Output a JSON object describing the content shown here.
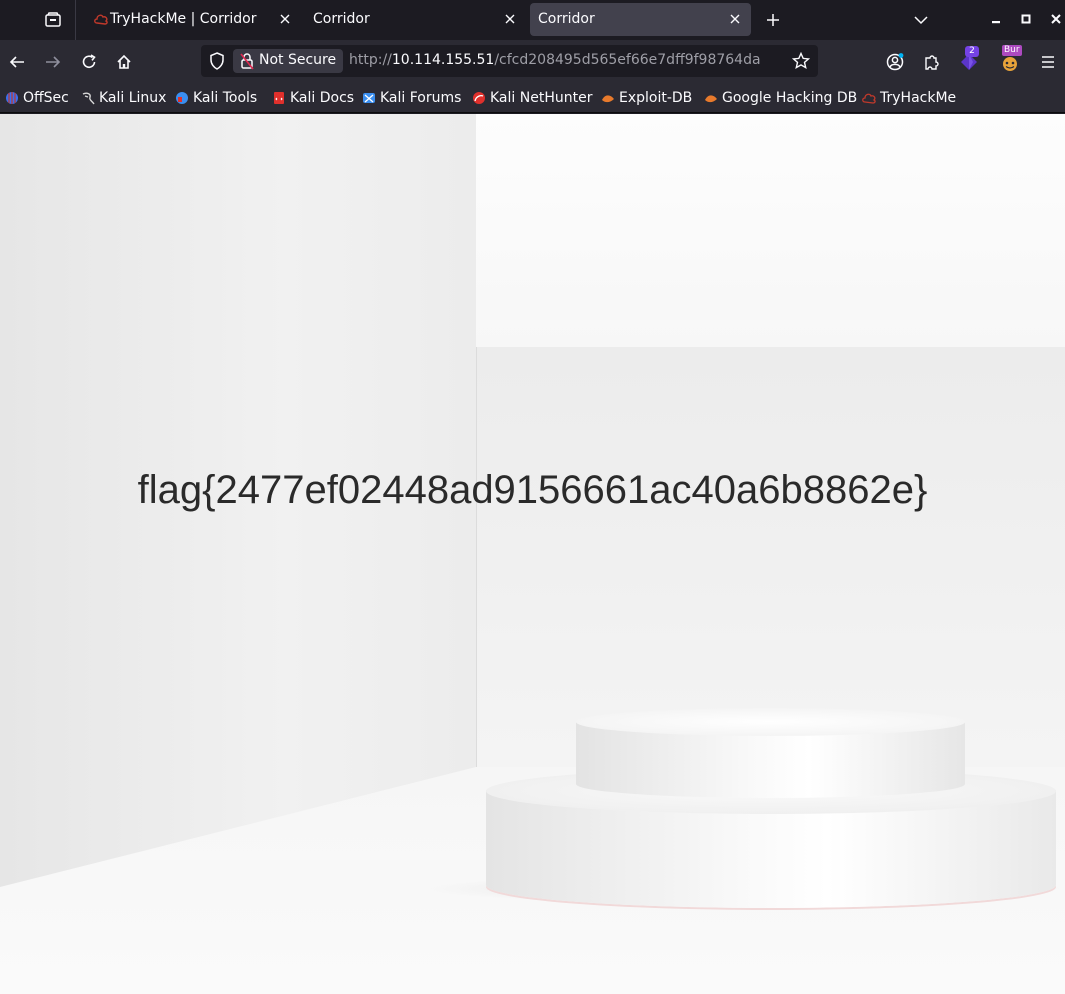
{
  "tabs": [
    {
      "title": "TryHackMe | Corridor",
      "active": false
    },
    {
      "title": "Corridor",
      "active": false
    },
    {
      "title": "Corridor",
      "active": true
    }
  ],
  "nav": {
    "security_label": "Not Secure",
    "url_protocol": "http://",
    "url_host": "10.114.155.51",
    "url_path": "/cfcd208495d565ef66e7dff9f98764da",
    "extension_badge": "2",
    "burp_label": "Bur"
  },
  "bookmarks": [
    {
      "label": "OffSec",
      "icon": "offsec-icon",
      "color": "#3a6ff0"
    },
    {
      "label": "Kali Linux",
      "icon": "kali-dragon-icon",
      "color": "#d8d8d8"
    },
    {
      "label": "Kali Tools",
      "icon": "kali-tools-icon",
      "color": "#3a8ef0"
    },
    {
      "label": "Kali Docs",
      "icon": "kali-docs-icon",
      "color": "#e0302c"
    },
    {
      "label": "Kali Forums",
      "icon": "kali-forums-icon",
      "color": "#3a8ef0"
    },
    {
      "label": "Kali NetHunter",
      "icon": "nethunter-icon",
      "color": "#e0302c"
    },
    {
      "label": "Exploit-DB",
      "icon": "exploit-db-icon",
      "color": "#e87a2c"
    },
    {
      "label": "Google Hacking DB",
      "icon": "ghdb-icon",
      "color": "#e87a2c"
    },
    {
      "label": "TryHackMe",
      "icon": "tryhackme-icon",
      "color": "#c0392b"
    }
  ],
  "page": {
    "flag_text": "flag{2477ef02448ad9156661ac40a6b8862e}"
  },
  "colors": {
    "tabbar_bg": "#1c1b22",
    "toolbar_bg": "#2b2a33",
    "active_tab_bg": "#42414d",
    "text": "#fbfbfe"
  }
}
